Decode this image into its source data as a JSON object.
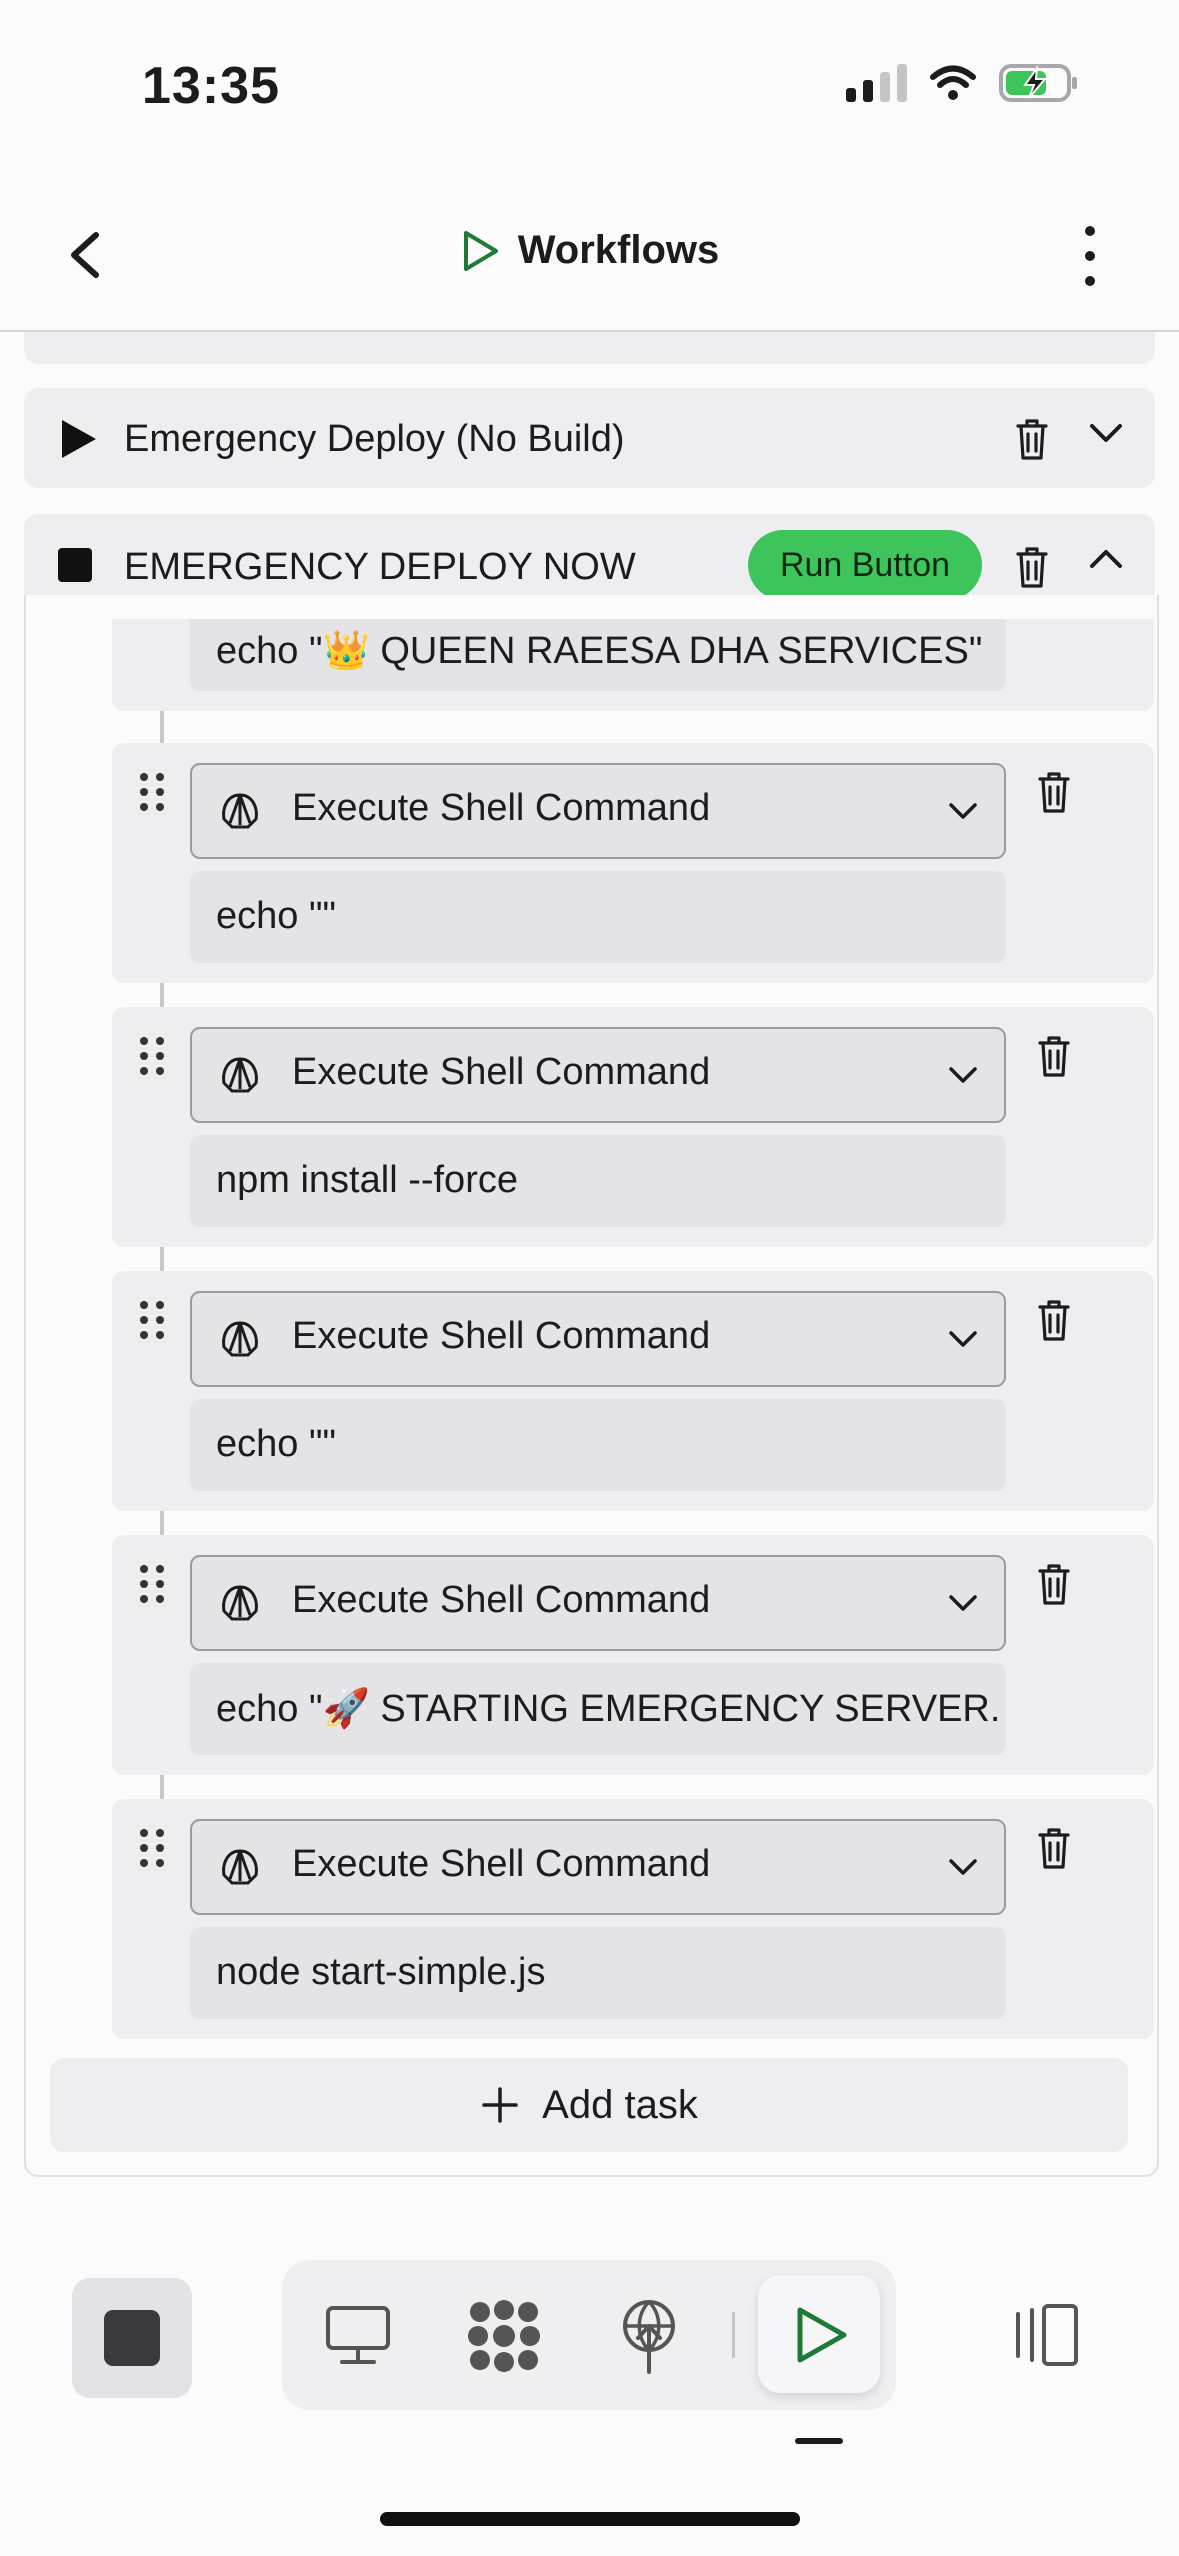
{
  "status_bar": {
    "time": "13:35"
  },
  "header": {
    "title": "Workflows"
  },
  "workflows": [
    {
      "title": "Emergency Deploy (No Build)"
    },
    {
      "title": "EMERGENCY DEPLOY NOW",
      "run_label": "Run Button"
    }
  ],
  "tasks": {
    "top_partial_command": "echo \"👑 QUEEN RAEESA DHA SERVICES\"",
    "items": [
      {
        "type": "Execute Shell Command",
        "command": "echo \"\""
      },
      {
        "type": "Execute Shell Command",
        "command": "npm install --force"
      },
      {
        "type": "Execute Shell Command",
        "command": "echo \"\""
      },
      {
        "type": "Execute Shell Command",
        "command": "echo \"🚀 STARTING EMERGENCY SERVER."
      },
      {
        "type": "Execute Shell Command",
        "command": "node start-simple.js"
      }
    ]
  },
  "add_task_label": "Add task",
  "colors": {
    "run_green": "#3dc45a",
    "play_green": "#1e7a34"
  }
}
